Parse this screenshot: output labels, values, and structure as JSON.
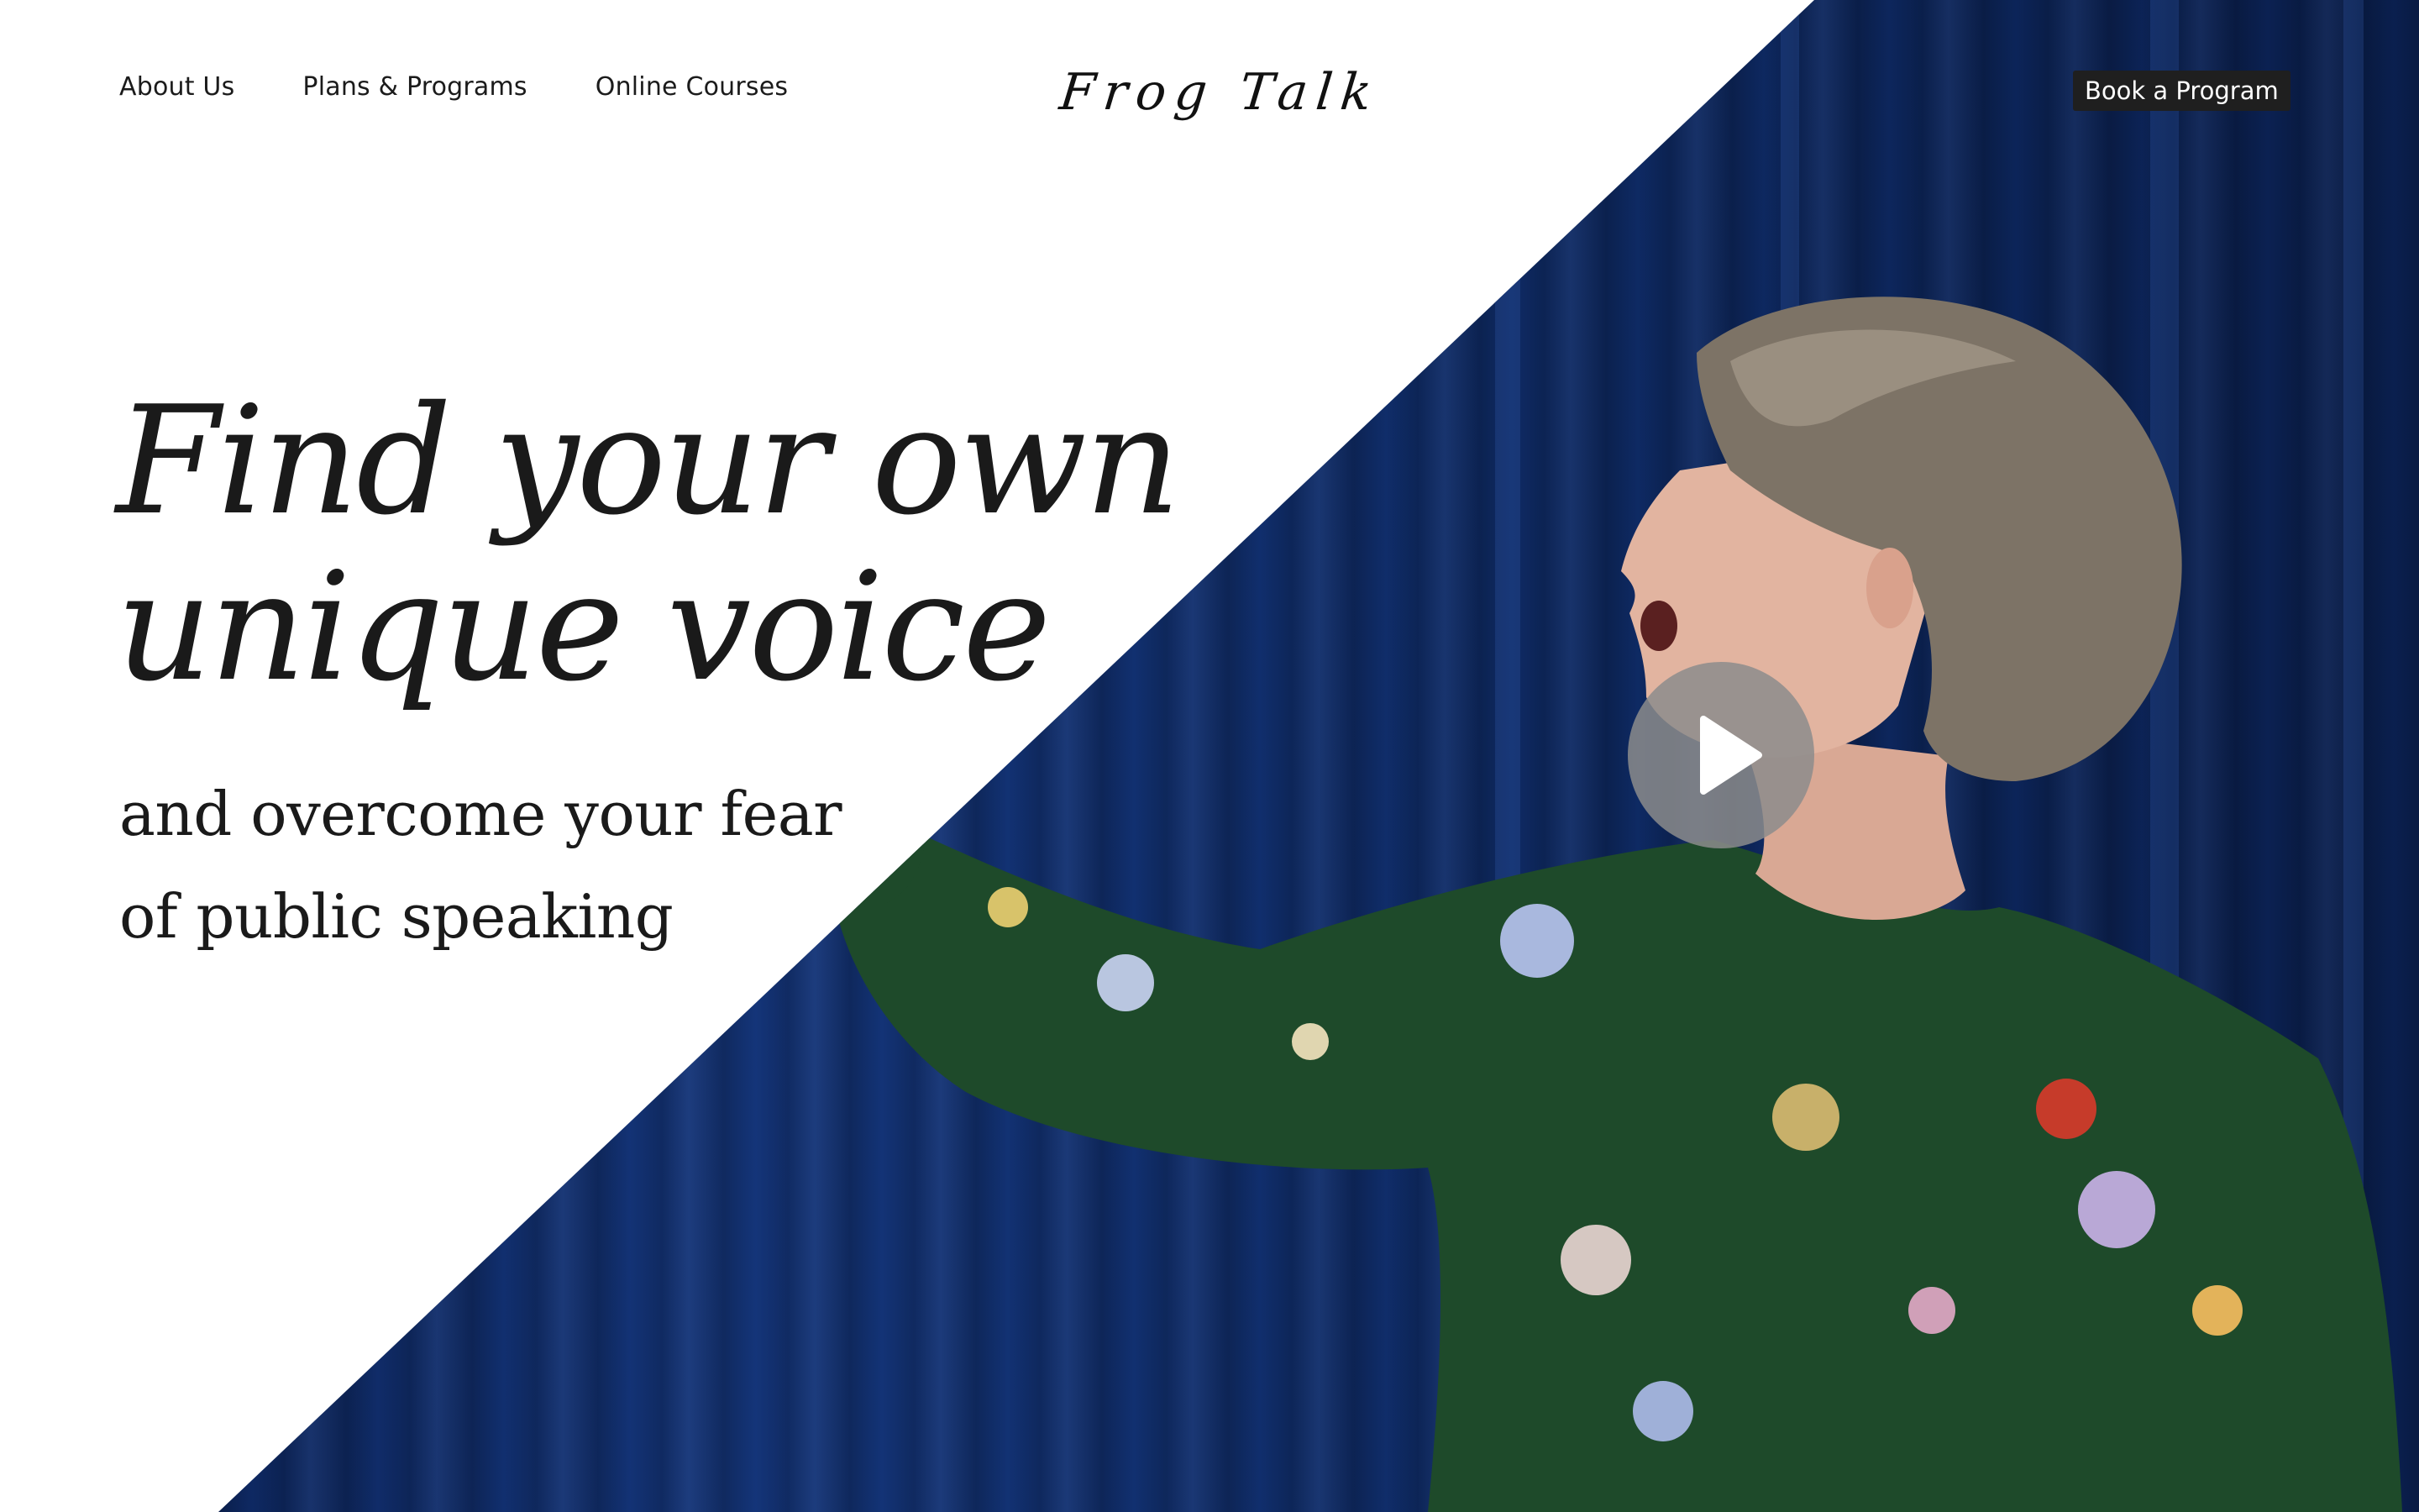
{
  "header": {
    "nav": [
      {
        "label": "About Us"
      },
      {
        "label": "Plans & Programs"
      },
      {
        "label": "Online Courses"
      }
    ],
    "logo_text": "Frog Talk",
    "cta_label": "Book a Program"
  },
  "hero": {
    "headline_line1": "Find your own",
    "headline_line2": "unique voice",
    "subhead_line1": "and overcome your fear",
    "subhead_line2": "of public speaking",
    "photo_alt": "Woman in a green floral blouse singing in front of a blue velvet curtain",
    "play_icon": "play-icon"
  },
  "colors": {
    "curtain": "#0f2c68",
    "blouse": "#1e4a2a",
    "text": "#1a1a1a",
    "cta_bg": "#1f1f1f"
  }
}
